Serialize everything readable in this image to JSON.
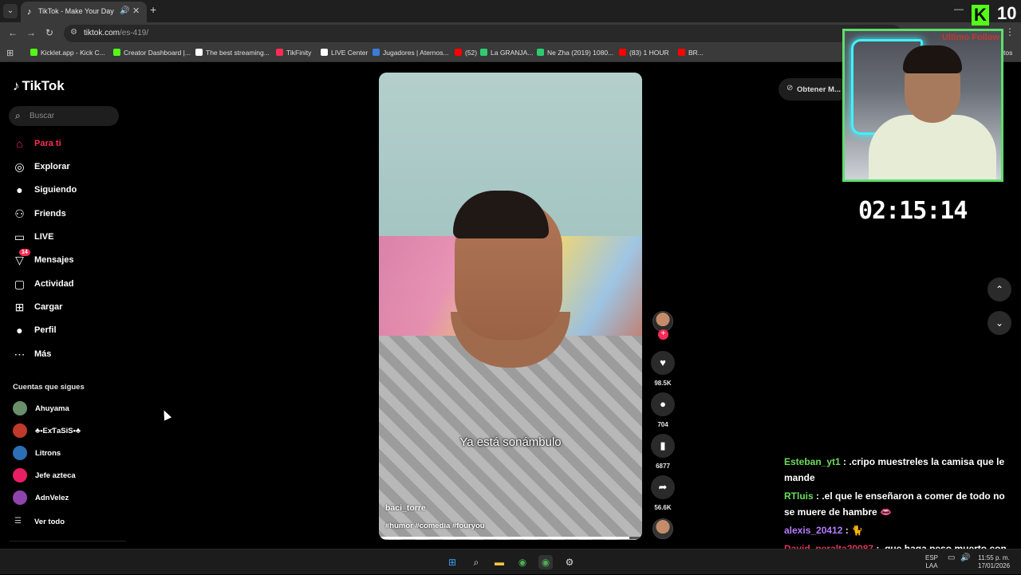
{
  "browser": {
    "tab_title": "TikTok - Make Your Day",
    "url_host": "tiktok.com",
    "url_path": "/es-419/",
    "bookmarks": [
      {
        "label": "Kicklet.app - Kick C...",
        "color": "#53fc18"
      },
      {
        "label": "Creator Dashboard |...",
        "color": "#53fc18"
      },
      {
        "label": "The best streaming...",
        "color": "#ffffff"
      },
      {
        "label": "TikFinity",
        "color": "#fe2c55"
      },
      {
        "label": "LIVE Center",
        "color": "#ffffff"
      },
      {
        "label": "Jugadores | Aternos...",
        "color": "#3b7dd8"
      },
      {
        "label": "(52)",
        "color": "#ff0000"
      },
      {
        "label": "La GRANJA...",
        "color": "#2ecc71"
      },
      {
        "label": "Ne Zha (2019) 1080...",
        "color": "#2ecc71"
      },
      {
        "label": "(83) 1 HOUR",
        "color": "#ff0000"
      },
      {
        "label": "BR...",
        "color": "#ff0000"
      }
    ],
    "bookmarks_overflow": "tos"
  },
  "tiktok": {
    "logo": "TikTok",
    "search_placeholder": "Buscar",
    "nav": [
      {
        "label": "Para ti",
        "icon": "home-icon",
        "glyph": "⌂",
        "active": true
      },
      {
        "label": "Explorar",
        "icon": "compass-icon",
        "glyph": "◎"
      },
      {
        "label": "Siguiendo",
        "icon": "following-icon",
        "glyph": "●"
      },
      {
        "label": "Friends",
        "icon": "friends-icon",
        "glyph": "⚇"
      },
      {
        "label": "LIVE",
        "icon": "live-icon",
        "glyph": "▭"
      },
      {
        "label": "Mensajes",
        "icon": "messages-icon",
        "glyph": "▽",
        "badge": "14"
      },
      {
        "label": "Actividad",
        "icon": "activity-icon",
        "glyph": "▢"
      },
      {
        "label": "Cargar",
        "icon": "upload-icon",
        "glyph": "⊞"
      },
      {
        "label": "Perfil",
        "icon": "profile-icon",
        "glyph": "●"
      },
      {
        "label": "Más",
        "icon": "more-icon",
        "glyph": "⋯"
      }
    ],
    "following_title": "Cuentas que sigues",
    "following": [
      {
        "name": "Ahuyama",
        "color": "#6a8f6a"
      },
      {
        "name": "♣•ExƬaSiS•♣",
        "color": "#c0392b"
      },
      {
        "name": "Litrons",
        "color": "#2d6fb5"
      },
      {
        "name": "Jefe azteca",
        "color": "#e91e63"
      },
      {
        "name": "AdnVelez",
        "color": "#8e44ad"
      }
    ],
    "see_all": "Ver todo",
    "get_app": "Obtener M..."
  },
  "video": {
    "caption": "Ya está sonámbulo",
    "author": "baci_torre",
    "tags": "#humor #comedia #fouryou",
    "progress": 0.95,
    "likes": "98.5K",
    "comments": "704",
    "saves": "6877",
    "shares": "56.6K"
  },
  "overlay": {
    "kick_count": "10",
    "webcam_label": "Ultimo Follow",
    "timer": "02:15:14"
  },
  "chat": [
    {
      "user": "Esteban_yt1",
      "color": "#6cdc5a",
      "text": ": .cripo muestreles la camisa que le mande"
    },
    {
      "user": "RTluis",
      "color": "#6cdc5a",
      "text": ": .el que le enseñaron a comer de todo no se muere de hambre 👄"
    },
    {
      "user": "alexis_20412",
      "color": "#b57cff",
      "text": ": 🐈"
    },
    {
      "user": "David_peralta20087",
      "color": "#e0365a",
      "text": ": .que haga peso muerto con la picha adentro"
    }
  ],
  "taskbar": {
    "lang_top": "ESP",
    "lang_bottom": "LAA",
    "time": "11:55 p. m.",
    "date": "17/01/2026"
  }
}
